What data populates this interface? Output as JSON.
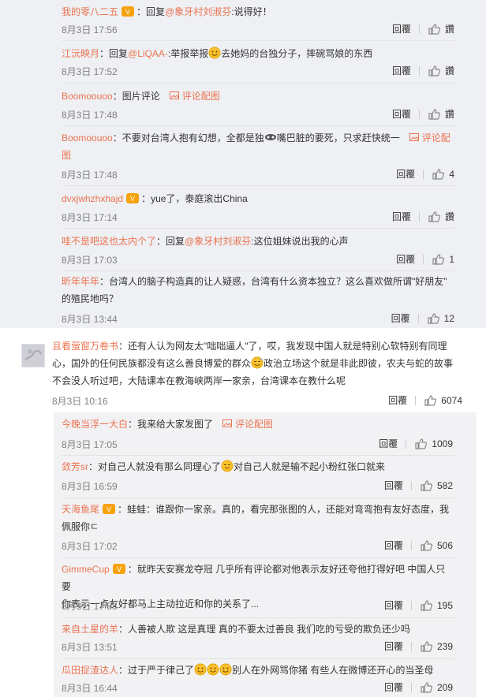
{
  "icons": {
    "badge": "vip-badge-icon",
    "like": "thumbs-up-icon",
    "pic": "picture-icon",
    "emoji": "smiley-emoji",
    "avatar": "avatar"
  },
  "colors": {
    "name": "#eb7350",
    "text": "#333333",
    "meta": "#808080"
  },
  "replies_top": [
    {
      "name": "我的零八二五",
      "body": "回复",
      "mention": "@象牙村刘淑芬",
      "text": ":说得好！",
      "time": "8月3日 17:56",
      "reply": "回覆",
      "like": "讚"
    },
    {
      "name": "江沅映月",
      "body_prefix": "回复",
      "mention": "@LiQAA-",
      "text_a": ":举报举报",
      "text_b": "去她妈的台独分子，摔碗骂娘的东西",
      "time": "8月3日 17:52",
      "reply": "回覆",
      "like": "讚"
    },
    {
      "name": "Boomoouoo",
      "text": "图片评论",
      "pic": "评论配图",
      "time": "8月3日 17:48",
      "reply": "回覆",
      "like": "讚"
    },
    {
      "name": "Boomoouoo",
      "text_a": "不要对台湾人抱有幻想，全都是独",
      "text_b": "嘴巴脏的要死，只求赶快统一",
      "pic": "评论配",
      "pic2": "图",
      "time": "8月3日 17:48",
      "reply": "回覆",
      "like": "4"
    },
    {
      "name": "dvxjwhzhxhajd",
      "text": "yue了，泰庭滚出China",
      "time": "8月3日 17:14",
      "reply": "回覆",
      "like": "讚"
    },
    {
      "name": "哇不是吧这也太内个了",
      "body_prefix": "回复",
      "mention": "@象牙村刘淑芬",
      "text": ":这位姐妹说出我的心声",
      "time": "8月3日 17:03",
      "reply": "回覆",
      "like": "1"
    },
    {
      "name": "昕年年年",
      "text_a": "台湾人的脑子构造真的让人疑惑，台湾有什么资本独立？这么喜欢做所谓\"好朋友\"",
      "text_b": "的殖民地吗？",
      "time": "8月3日 13:44",
      "reply": "回覆",
      "like": "12"
    }
  ],
  "thread": {
    "name": "且看萤窗万卷书",
    "text_a": "还有人认为网友太\"咄咄逼人\"了，哎，我发现中国人就是特别心软特别有同理",
    "text_b": "心，国外的任何民族都没有这么善良博爱的群众",
    "text_c": "政治立场这个就是非此即彼，农夫与蛇的故事",
    "text_d": "不会没人听过吧，大陆课本在教海峡两岸一家亲，台湾课本在教什么呢",
    "time": "8月3日 10:16",
    "reply": "回覆",
    "like": "6074"
  },
  "replies_bottom": [
    {
      "name": "今晚当浮一大白",
      "text": "我来给大家发图了",
      "pic": "评论配图",
      "time": "8月3日 17:05",
      "reply": "回覆",
      "like": "1009"
    },
    {
      "name": "敛芳sr",
      "text_a": "对自己人就没有那么同理心了",
      "text_b": "对自己人就是输不起小粉红张口就来",
      "time": "8月3日 16:59",
      "reply": "回覆",
      "like": "582"
    },
    {
      "name": "天海鱼尾",
      "text_a": "蛙蛙：谁跟你一家亲。真的，看完那张图的人，还能对弯弯抱有友好态度，我",
      "text_b": "佩服你ㄷ",
      "time": "8月3日 17:02",
      "reply": "回覆",
      "like": "506"
    },
    {
      "name": "GimmeCup",
      "text_a": "就昨天安赛龙夺冠 几乎所有评论都对他表示友好还夸他打得好吧 中国人只要",
      "text_b": "你表示一点友好都马上主动拉近和你的关系了...",
      "time": "8月3日 17:58",
      "reply": "回覆",
      "like": "195"
    },
    {
      "name": "来自土星的羊",
      "text": "人善被人欺 这是真理 真的不要太过善良 我们吃的亏受的欺负还少吗",
      "time": "8月3日 13:51",
      "reply": "回覆",
      "like": "239"
    },
    {
      "name": "瓜田捉渣达人",
      "text_a": "过于严于律己了",
      "text_b": "别人在外网骂你猪 有些人在微博还开心的当圣母",
      "time": "8月3日 16:44",
      "reply": "回覆",
      "like": "209"
    }
  ]
}
